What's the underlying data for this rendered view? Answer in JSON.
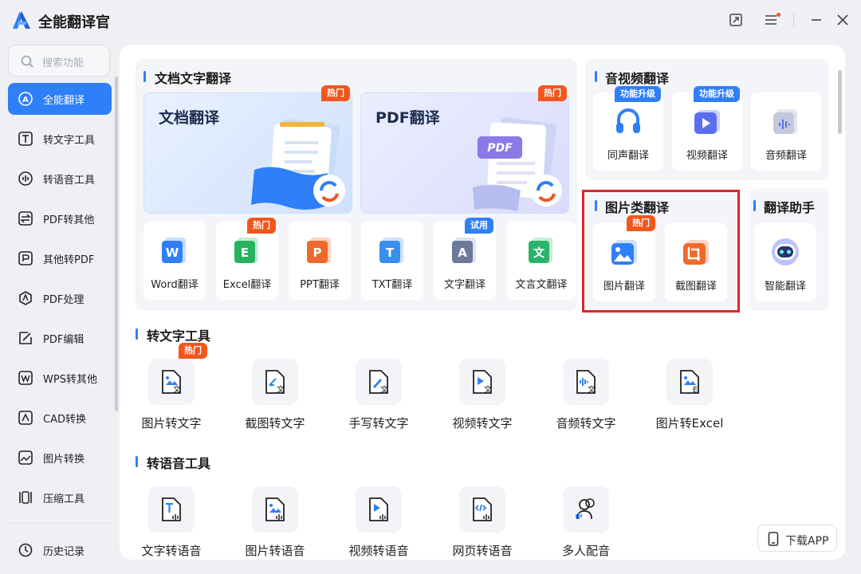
{
  "app": {
    "title": "全能翻译官"
  },
  "colors": {
    "accent": "#2f7ff8",
    "hot": "#f2561d",
    "highlight": "#e0262a"
  },
  "sidebar": {
    "search_placeholder": "搜索功能",
    "items": [
      {
        "label": "全能翻译",
        "icon": "translate-icon",
        "active": true
      },
      {
        "label": "转文字工具",
        "icon": "text-tool-icon"
      },
      {
        "label": "转语音工具",
        "icon": "voice-tool-icon"
      },
      {
        "label": "PDF转其他",
        "icon": "pdf-convert-icon"
      },
      {
        "label": "其他转PDF",
        "icon": "to-pdf-icon"
      },
      {
        "label": "PDF处理",
        "icon": "pdf-process-icon"
      },
      {
        "label": "PDF编辑",
        "icon": "pdf-edit-icon"
      },
      {
        "label": "WPS转其他",
        "icon": "wps-icon"
      },
      {
        "label": "CAD转换",
        "icon": "cad-icon"
      },
      {
        "label": "图片转换",
        "icon": "image-convert-icon"
      },
      {
        "label": "压缩工具",
        "icon": "compress-icon"
      }
    ],
    "history": "历史记录"
  },
  "doc_section": {
    "title": "文档文字翻译",
    "big_cards": [
      {
        "label": "文档翻译",
        "badge": "热门"
      },
      {
        "label": "PDF翻译",
        "badge": "热门"
      }
    ],
    "tiles": [
      {
        "label": "Word翻译",
        "glyph": "W",
        "color": "#2f7ff8"
      },
      {
        "label": "Excel翻译",
        "glyph": "E",
        "color": "#27b35e",
        "badge": "热门"
      },
      {
        "label": "PPT翻译",
        "glyph": "P",
        "color": "#f0692a"
      },
      {
        "label": "TXT翻译",
        "glyph": "T",
        "color": "#3a8ef0"
      },
      {
        "label": "文字翻译",
        "glyph": "A",
        "color": "#6b7a99",
        "badge": "试用"
      },
      {
        "label": "文言文翻译",
        "glyph": "文",
        "color": "#2bb36a"
      }
    ]
  },
  "av_section": {
    "title": "音视频翻译",
    "tiles": [
      {
        "label": "同声翻译",
        "badge": "功能升级"
      },
      {
        "label": "视频翻译",
        "badge": "功能升级"
      },
      {
        "label": "音频翻译"
      }
    ]
  },
  "image_section": {
    "title": "图片类翻译",
    "tiles": [
      {
        "label": "图片翻译",
        "badge": "热门"
      },
      {
        "label": "截图翻译"
      }
    ]
  },
  "assistant_section": {
    "title": "翻译助手",
    "tiles": [
      {
        "label": "智能翻译"
      }
    ]
  },
  "text_tools": {
    "title": "转文字工具",
    "items": [
      {
        "label": "图片转文字",
        "badge": "热门"
      },
      {
        "label": "截图转文字"
      },
      {
        "label": "手写转文字"
      },
      {
        "label": "视频转文字"
      },
      {
        "label": "音频转文字"
      },
      {
        "label": "图片转Excel"
      }
    ]
  },
  "voice_tools": {
    "title": "转语音工具",
    "items": [
      {
        "label": "文字转语音"
      },
      {
        "label": "图片转语音"
      },
      {
        "label": "视频转语音"
      },
      {
        "label": "网页转语音"
      },
      {
        "label": "多人配音"
      }
    ]
  },
  "download": {
    "label": "下载APP"
  }
}
